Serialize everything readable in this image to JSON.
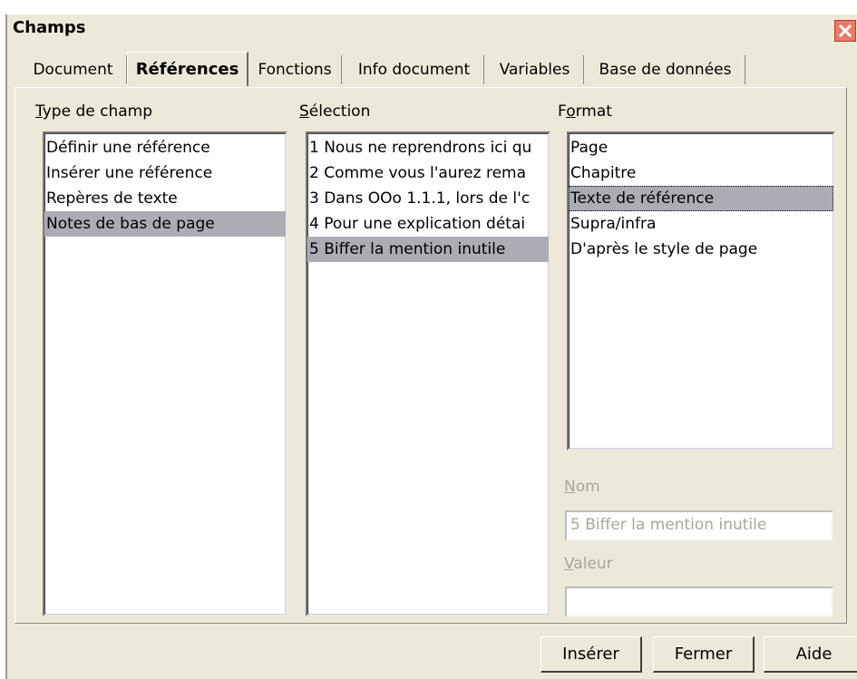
{
  "window": {
    "title": "Champs"
  },
  "tabs": [
    {
      "label": "Document",
      "active": false
    },
    {
      "label": "Références",
      "active": true
    },
    {
      "label": "Fonctions",
      "active": false
    },
    {
      "label": "Info document",
      "active": false
    },
    {
      "label": "Variables",
      "active": false
    },
    {
      "label": "Base de données",
      "active": false
    }
  ],
  "field_type": {
    "label_mnemonic": "T",
    "label_rest": "ype de champ",
    "items": [
      "Définir une référence",
      "Insérer une référence",
      "Repères de texte",
      "Notes de bas de page"
    ],
    "selected_index": 3
  },
  "selection": {
    "label_mnemonic": "S",
    "label_rest": "élection",
    "items": [
      "1 Nous ne reprendrons ici qu",
      "2 Comme vous l'aurez rema",
      "3 Dans OOo 1.1.1, lors de l'c",
      "4  Pour une explication détai",
      "5 Biffer la mention inutile"
    ],
    "selected_index": 4
  },
  "format": {
    "label_pre": "F",
    "label_mnemonic": "o",
    "label_rest": "rmat",
    "items": [
      "Page",
      "Chapitre",
      "Texte de référence",
      "Supra/infra",
      "D'après le style de page"
    ],
    "selected_index": 2
  },
  "name_field": {
    "label_mnemonic": "N",
    "label_rest": "om",
    "value": "5 Biffer la mention inutile"
  },
  "value_field": {
    "label_mnemonic": "V",
    "label_rest": "aleur",
    "value": ""
  },
  "buttons": {
    "insert": "Insérer",
    "close": "Fermer",
    "help": "Aide"
  },
  "colors": {
    "dialog_bg": "#ece9d8",
    "selection_bg": "#acacb4",
    "disabled_text": "#a8a898"
  }
}
